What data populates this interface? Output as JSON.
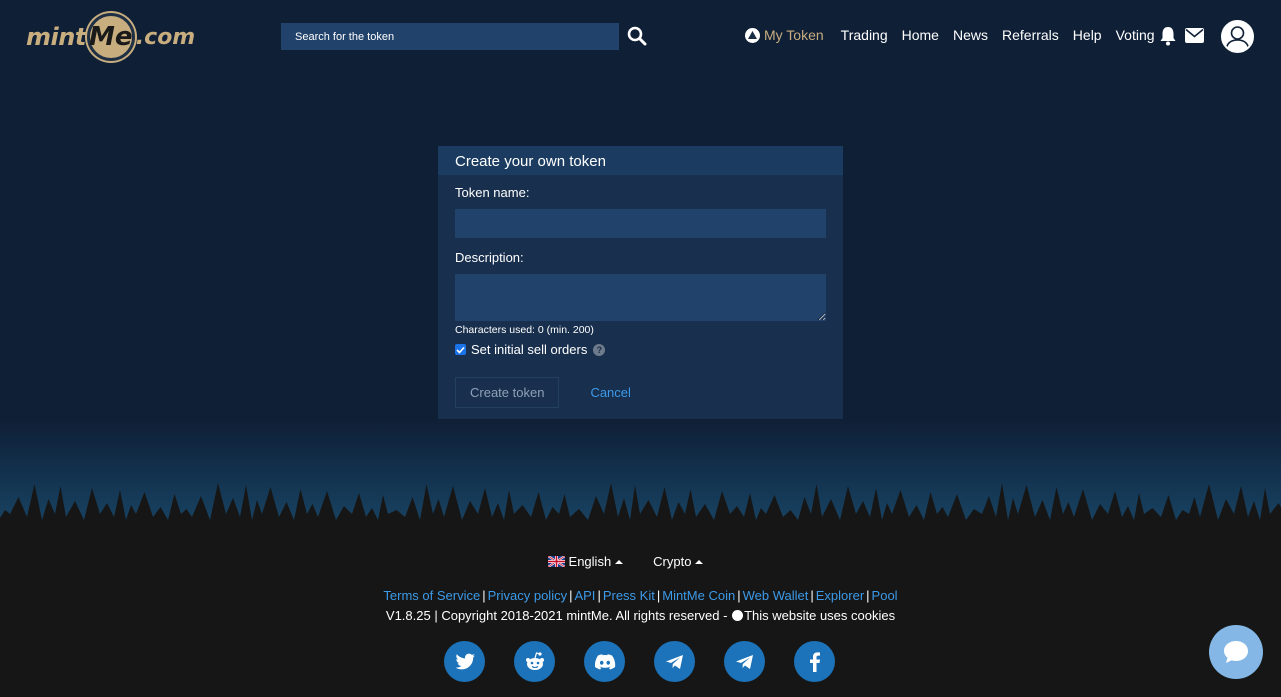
{
  "header": {
    "logo": {
      "mint": "mint",
      "me": "Me",
      "com": ".com"
    },
    "search": {
      "placeholder": "Search for the token"
    },
    "nav": {
      "my_token": "My Token",
      "items": [
        "Trading",
        "Home",
        "News",
        "Referrals",
        "Help",
        "Voting"
      ]
    }
  },
  "form": {
    "title": "Create your own token",
    "token_name_label": "Token name:",
    "token_name_value": "",
    "description_label": "Description:",
    "description_value": "",
    "char_count": "Characters used: 0 (min. 200)",
    "checkbox_label": "Set initial sell orders",
    "checkbox_checked": true,
    "help": "?",
    "create_button": "Create token",
    "cancel_link": "Cancel"
  },
  "footer": {
    "language": "English",
    "currency": "Crypto",
    "links": [
      "Terms of Service",
      "Privacy policy",
      "API",
      "Press Kit",
      "MintMe Coin",
      "Web Wallet",
      "Explorer",
      "Pool"
    ],
    "copyright_prefix": "V1.8.25 | Copyright 2018-2021 mintMe. All rights reserved - ",
    "cookies": "This website uses cookies",
    "socials": [
      "twitter-icon",
      "reddit-icon",
      "discord-icon",
      "telegram-icon",
      "telegram-icon",
      "facebook-icon"
    ]
  },
  "colors": {
    "background": "#0f1f36",
    "accent_gold": "#c8ad7f",
    "link_blue": "#3c9ae8",
    "input_bg": "#21426a",
    "social_blue": "#1c73b9"
  }
}
